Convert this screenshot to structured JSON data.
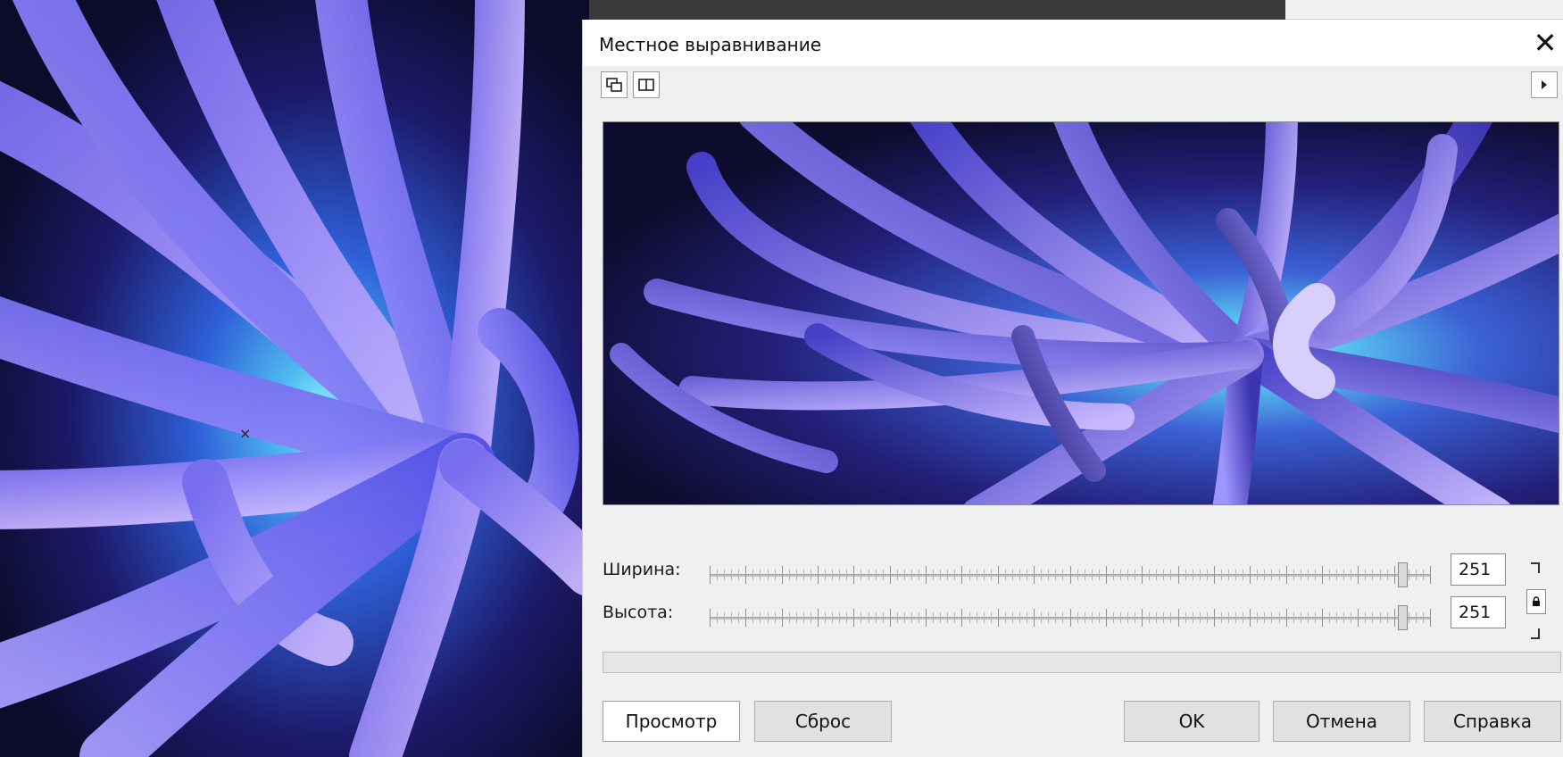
{
  "dialog": {
    "title": "Местное выравнивание",
    "close_icon": "✕"
  },
  "toolbar": {
    "icons": [
      "preview-overlay-icon",
      "split-view-icon"
    ],
    "expand_icon": "play-right-icon"
  },
  "sliders": {
    "width": {
      "label": "Ширина:",
      "value": "251",
      "level": 0.98
    },
    "height": {
      "label": "Высота:",
      "value": "251",
      "level": 0.98
    }
  },
  "lock": {
    "icon": "lock-icon"
  },
  "progress": {
    "level": 0
  },
  "buttons": {
    "preview": "Просмотр",
    "reset": "Сброс",
    "ok": "OK",
    "cancel": "Отмена",
    "help": "Справка"
  },
  "canvas": {
    "marker": "×"
  },
  "colors": {
    "accent": "#3c62d6",
    "dialog_bg": "#f0f0f0"
  }
}
